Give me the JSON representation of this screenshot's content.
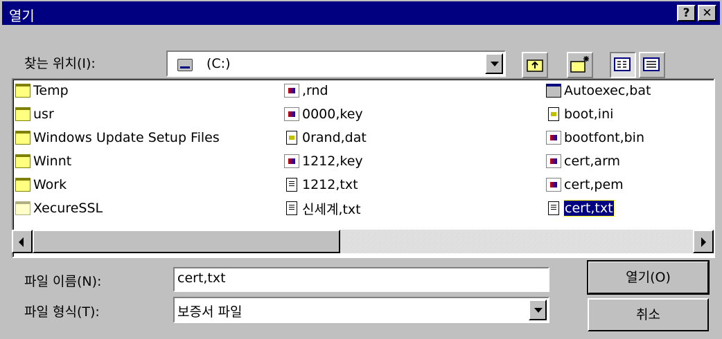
{
  "window": {
    "title": "열기",
    "help_label": "?",
    "close_label": "✕"
  },
  "look_in": {
    "label": "찾는 위치(I):",
    "value": "(C:)",
    "icon": "drive-icon"
  },
  "toolbar": [
    {
      "name": "up-one-level-button",
      "icon": "folder-up-icon"
    },
    {
      "name": "new-folder-button",
      "icon": "new-folder-icon"
    },
    {
      "name": "list-view-button",
      "icon": "list-view-icon"
    },
    {
      "name": "details-view-button",
      "icon": "details-view-icon"
    }
  ],
  "files": {
    "col1": [
      {
        "name": "Temp",
        "icon": "folder"
      },
      {
        "name": "usr",
        "icon": "folder"
      },
      {
        "name": "Windows Update Setup Files",
        "icon": "folder"
      },
      {
        "name": "Winnt",
        "icon": "folder"
      },
      {
        "name": "Work",
        "icon": "folder"
      },
      {
        "name": "XecureSSL",
        "icon": "folder-light"
      }
    ],
    "col2": [
      {
        "name": ",rnd",
        "icon": "img"
      },
      {
        "name": "0000,key",
        "icon": "img"
      },
      {
        "name": "0rand,dat",
        "icon": "cfg"
      },
      {
        "name": "1212,key",
        "icon": "img"
      },
      {
        "name": "1212,txt",
        "icon": "doc"
      },
      {
        "name": "신세계,txt",
        "icon": "doc"
      }
    ],
    "col3": [
      {
        "name": "Autoexec,bat",
        "icon": "win"
      },
      {
        "name": "boot,ini",
        "icon": "cfg"
      },
      {
        "name": "bootfont,bin",
        "icon": "img"
      },
      {
        "name": "cert,arm",
        "icon": "img"
      },
      {
        "name": "cert,pem",
        "icon": "img"
      },
      {
        "name": "cert,txt",
        "icon": "doc",
        "selected": true
      }
    ]
  },
  "filename": {
    "label": "파일 이름(N):",
    "value": "cert,txt"
  },
  "filetype": {
    "label": "파일 형식(T):",
    "value": "보증서 파일"
  },
  "buttons": {
    "open": "열기(O)",
    "cancel": "취소"
  }
}
